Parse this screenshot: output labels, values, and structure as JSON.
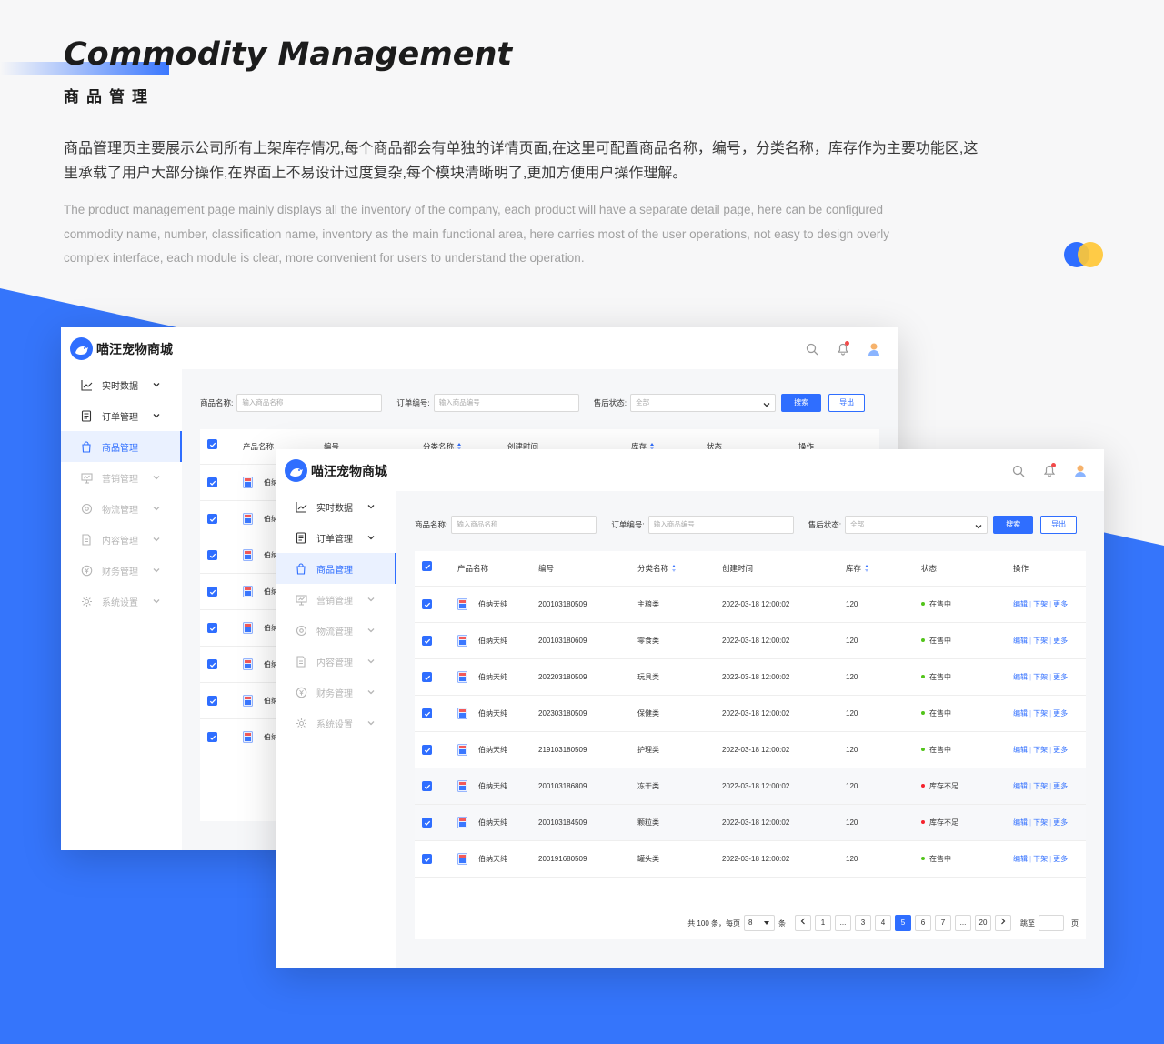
{
  "hero": {
    "title_en": "Commodity Management",
    "title_cn": "商品管理",
    "desc_cn": "商品管理页主要展示公司所有上架库存情况,每个商品都会有单独的详情页面,在这里可配置商品名称，编号，分类名称，库存作为主要功能区,这里承载了用户大部分操作,在界面上不易设计过度复杂,每个模块清晰明了,更加方便用户操作理解。",
    "desc_en": "The product management page mainly displays all the inventory of the company, each product will have a separate detail page, here can be configured commodity name, number, classification name, inventory as the main functional area, here carries most of the user operations, not easy to design overly complex interface, each module is clear, more convenient for users to understand the operation."
  },
  "app": {
    "title": "喵汪宠物商城"
  },
  "sidebar": {
    "items": [
      {
        "label": "实时数据",
        "icon": "line-chart-icon",
        "state": "normal"
      },
      {
        "label": "订单管理",
        "icon": "document-icon",
        "state": "normal"
      },
      {
        "label": "商品管理",
        "icon": "shopping-bag-icon",
        "state": "active"
      },
      {
        "label": "营销管理",
        "icon": "presentation-icon",
        "state": "disabled"
      },
      {
        "label": "物流管理",
        "icon": "disc-icon",
        "state": "disabled"
      },
      {
        "label": "内容管理",
        "icon": "file-text-icon",
        "state": "disabled"
      },
      {
        "label": "财务管理",
        "icon": "yen-circle-icon",
        "state": "disabled"
      },
      {
        "label": "系统设置",
        "icon": "gear-icon",
        "state": "disabled"
      }
    ]
  },
  "filters": {
    "name_label": "商品名称:",
    "name_placeholder": "输入商品名称",
    "order_label": "订单编号:",
    "order_placeholder": "输入商品编号",
    "status_label": "售后状态:",
    "status_value": "全部",
    "search_btn": "搜索",
    "export_btn": "导出"
  },
  "table": {
    "headers": {
      "name": "产品名称",
      "code": "编号",
      "category": "分类名称",
      "created": "创建时间",
      "stock": "库存",
      "status": "状态",
      "ops": "操作"
    },
    "ops": {
      "edit": "编辑",
      "off": "下架",
      "more": "更多"
    },
    "rows": [
      {
        "name": "伯纳天纯",
        "code": "200103180509",
        "category": "主粮类",
        "created": "2022-03-18 12:00:02",
        "stock": "120",
        "status": "在售中",
        "status_color": "#52c41a"
      },
      {
        "name": "伯纳天纯",
        "code": "200103180609",
        "category": "零食类",
        "created": "2022-03-18 12:00:02",
        "stock": "120",
        "status": "在售中",
        "status_color": "#52c41a"
      },
      {
        "name": "伯纳天纯",
        "code": "202203180509",
        "category": "玩具类",
        "created": "2022-03-18 12:00:02",
        "stock": "120",
        "status": "在售中",
        "status_color": "#52c41a"
      },
      {
        "name": "伯纳天纯",
        "code": "202303180509",
        "category": "保健类",
        "created": "2022-03-18 12:00:02",
        "stock": "120",
        "status": "在售中",
        "status_color": "#52c41a"
      },
      {
        "name": "伯纳天纯",
        "code": "219103180509",
        "category": "护理类",
        "created": "2022-03-18 12:00:02",
        "stock": "120",
        "status": "在售中",
        "status_color": "#52c41a"
      },
      {
        "name": "伯纳天纯",
        "code": "200103186809",
        "category": "冻干类",
        "created": "2022-03-18 12:00:02",
        "stock": "120",
        "status": "库存不足",
        "status_color": "#f5222d"
      },
      {
        "name": "伯纳天纯",
        "code": "200103184509",
        "category": "颗粒类",
        "created": "2022-03-18 12:00:02",
        "stock": "120",
        "status": "库存不足",
        "status_color": "#f5222d"
      },
      {
        "name": "伯纳天纯",
        "code": "200191680509",
        "category": "罐头类",
        "created": "2022-03-18 12:00:02",
        "stock": "120",
        "status": "在售中",
        "status_color": "#52c41a"
      }
    ],
    "back_row_name_partial": "伯纳"
  },
  "pagination": {
    "total_text": "共 100 条，每页",
    "per_page": "8",
    "per_page_unit": "条",
    "pages": [
      "1",
      "...",
      "3",
      "4",
      "5",
      "6",
      "7",
      "...",
      "20"
    ],
    "current": "5",
    "jump_label": "跳至",
    "page_unit": "页"
  },
  "colors": {
    "primary": "#2f6eff",
    "background_blue": "#3575fb",
    "accent_yellow": "#ffc736"
  }
}
